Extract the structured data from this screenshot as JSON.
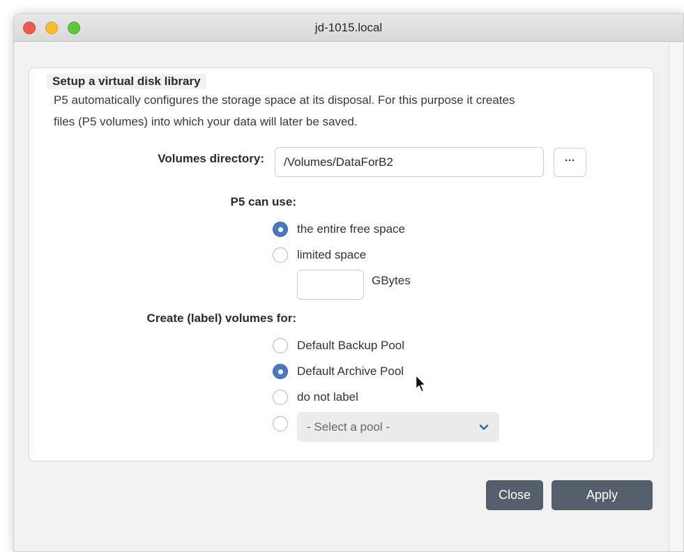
{
  "window": {
    "title": "jd-1015.local"
  },
  "group": {
    "legend": "Setup a virtual disk library",
    "intro_line1": "P5 automatically configures the storage space at its disposal. For this purpose it creates",
    "intro_line2": "files (P5 volumes) into which your data will later be saved."
  },
  "volumes_directory": {
    "label": "Volumes directory:",
    "value": "/Volumes/DataForB2",
    "browse_label": "···"
  },
  "space": {
    "label": "P5 can use:",
    "options": [
      {
        "label": "the entire free space",
        "selected": true
      },
      {
        "label": "limited space",
        "selected": false
      }
    ],
    "limit_value": "",
    "unit": "GBytes"
  },
  "label_volumes": {
    "label": "Create (label) volumes for:",
    "options": [
      {
        "label": "Default Backup Pool",
        "selected": false
      },
      {
        "label": "Default Archive Pool",
        "selected": true
      },
      {
        "label": "do not label",
        "selected": false
      }
    ],
    "custom_pool_placeholder": "- Select a pool -",
    "custom_pool_selected": false
  },
  "buttons": {
    "close": "Close",
    "apply": "Apply"
  },
  "colors": {
    "accent": "#4b76c0",
    "button": "#555f6c"
  }
}
